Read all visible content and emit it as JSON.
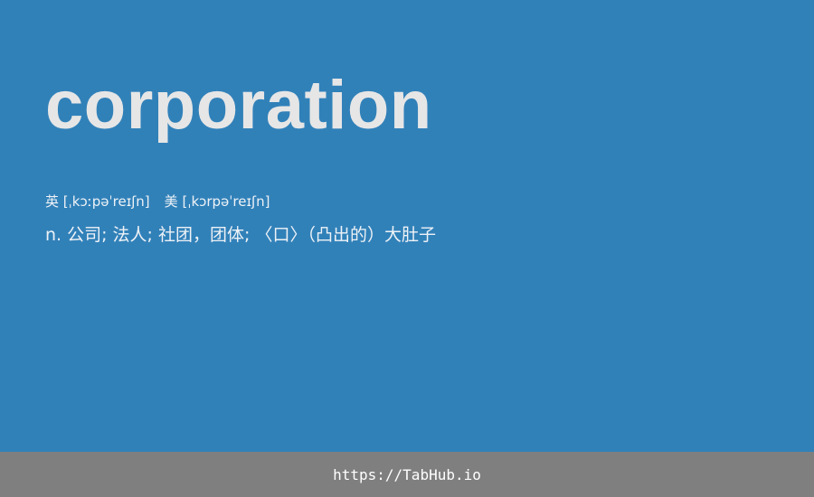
{
  "entry": {
    "word": "corporation",
    "phonetics": {
      "uk_label": "英",
      "uk_ipa": "[ˌkɔːpəˈreɪʃn]",
      "us_label": "美",
      "us_ipa": "[ˌkɔrpəˈreɪʃn]"
    },
    "definition": "n. 公司; 法人; 社团，团体; 〈口〉（凸出的）大肚子"
  },
  "footer": {
    "link": "https://TabHub.io"
  },
  "colors": {
    "background": "#3181b9",
    "word": "#e6e6e6",
    "footer_bg": "#7f7f7f"
  }
}
